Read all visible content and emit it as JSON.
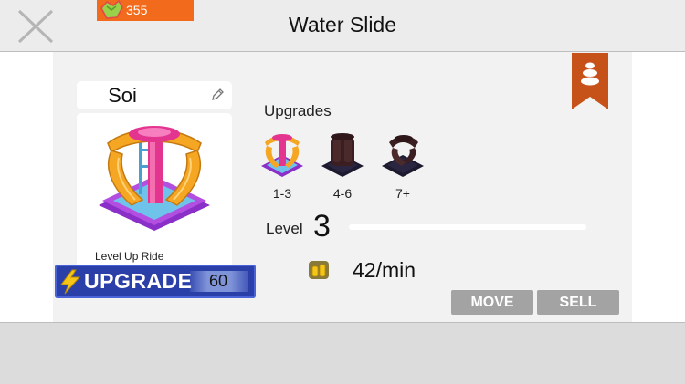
{
  "header": {
    "title": "Water Slide",
    "currency": {
      "value": "355",
      "icon": "gem-currency-icon",
      "color": "#f26a1b"
    }
  },
  "ride": {
    "name": "Soi",
    "caption": "Level Up Ride"
  },
  "upgrade_button": {
    "label": "UPGRADE",
    "cost": "60",
    "color": "#2a3fa8"
  },
  "upgrades": {
    "title": "Upgrades",
    "items": [
      {
        "range": "1-3",
        "unlocked": true
      },
      {
        "range": "4-6",
        "unlocked": false
      },
      {
        "range": "7+",
        "unlocked": false
      }
    ]
  },
  "level": {
    "label": "Level",
    "value": "3",
    "progress_fraction": 0.0
  },
  "income": {
    "value": "42/min",
    "icon": "coin-stack-icon"
  },
  "actions": {
    "move_label": "MOVE",
    "sell_label": "SELL"
  },
  "theme": {
    "accent": "#f26a1b",
    "bookmark": "#c6521a",
    "button_gray": "#a3a3a3"
  }
}
